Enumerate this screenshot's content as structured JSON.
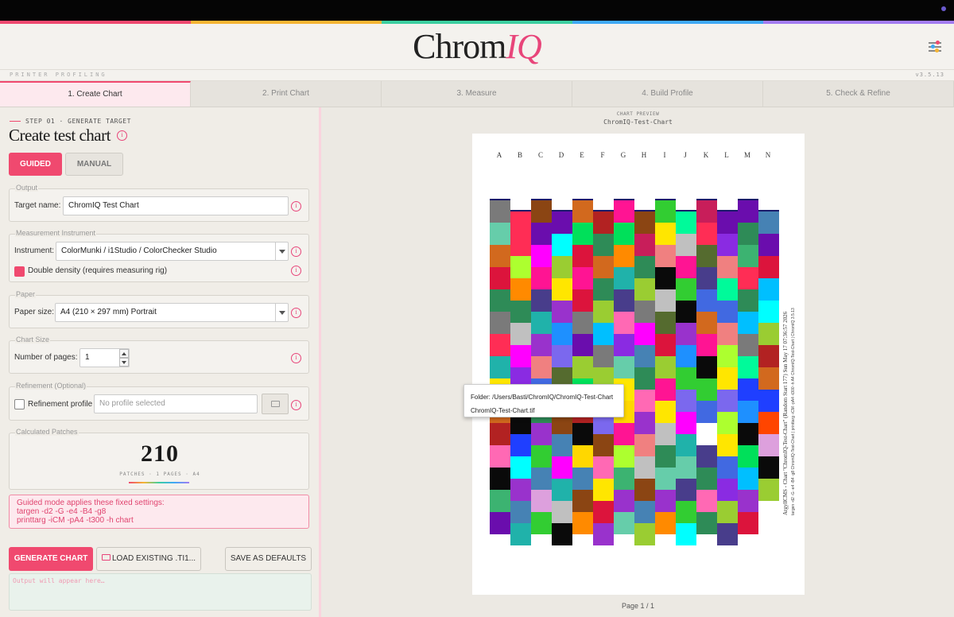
{
  "app": {
    "logo_main": "Chrom",
    "logo_accent": "IQ",
    "subtitle": "PRINTER PROFILING",
    "version": "v3.5.13"
  },
  "tabs": [
    {
      "label": "1. Create Chart",
      "active": true
    },
    {
      "label": "2. Print Chart",
      "active": false
    },
    {
      "label": "3. Measure",
      "active": false
    },
    {
      "label": "4. Build Profile",
      "active": false
    },
    {
      "label": "5. Check & Refine",
      "active": false
    }
  ],
  "step": {
    "kicker": "STEP 01 · GENERATE TARGET",
    "title": "Create test chart",
    "info_glyph": "i"
  },
  "modes": {
    "guided": "GUIDED",
    "manual": "MANUAL",
    "selected": "guided"
  },
  "output_group": {
    "legend": "Output",
    "target_label": "Target name:",
    "target_value": "ChromIQ Test Chart"
  },
  "instrument_group": {
    "legend": "Measurement Instrument",
    "instrument_label": "Instrument:",
    "instrument_value": "ColorMunki / i1Studio / ColorChecker Studio",
    "double_density_label": "Double density (requires measuring rig)",
    "double_density_checked": true
  },
  "paper_group": {
    "legend": "Paper",
    "paper_label": "Paper size:",
    "paper_value": "A4 (210 × 297 mm) Portrait"
  },
  "chart_size_group": {
    "legend": "Chart Size",
    "pages_label": "Number of pages:",
    "pages_value": "1"
  },
  "refinement_group": {
    "legend": "Refinement (Optional)",
    "refinement_label": "Refinement profile",
    "refinement_checked": false,
    "refinement_placeholder": "No profile selected"
  },
  "patches_group": {
    "legend": "Calculated Patches",
    "count": "210",
    "sub": "PATCHES · 1 PAGES · A4"
  },
  "notice": {
    "line1": "Guided mode applies these fixed settings:",
    "line2": "targen -d2 -G -e4 -B4 -g8",
    "line3": "printtarg -iCM -pA4 -t300 -h chart"
  },
  "actions": {
    "generate": "GENERATE CHART",
    "load": "LOAD EXISTING .TI1...",
    "save_defaults": "SAVE AS DEFAULTS"
  },
  "output_log": {
    "placeholder": "Output will appear here…"
  },
  "preview": {
    "label": "CHART PREVIEW",
    "name": "ChromIQ-Test-Chart",
    "columns": [
      "A",
      "B",
      "C",
      "D",
      "E",
      "F",
      "G",
      "H",
      "I",
      "J",
      "K",
      "L",
      "M",
      "N"
    ],
    "side_text": "ArgyllCMS - Chart \"ChromIQ-Test-Chart\" (Random Start 177) Sun May 17 07:36:57 2026",
    "side_text_small": "targen -d2 -G -e4 -B4 -g8 ChromIQ-Test-Chart  |  printtarg -iCM -pA4 -t300 -h A4 ChromIQ-Test-Chart  |  ChromIQ 3.5.13",
    "page_indicator": "Page 1 / 1"
  },
  "tooltip": {
    "folder": "Folder: /Users/Basti/ChromIQ/ChromIQ-Test-Chart",
    "file": "ChromIQ-Test-Chart.tif"
  },
  "colors": {
    "accent": "#f0496f",
    "panel": "#f0ede7",
    "notice_bg": "#fde9ee"
  }
}
